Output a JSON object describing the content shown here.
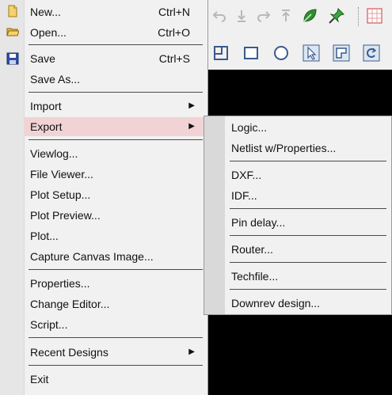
{
  "file_menu": {
    "items": [
      {
        "label": "New...",
        "shortcut": "Ctrl+N",
        "icon": "new-file-icon"
      },
      {
        "label": "Open...",
        "shortcut": "Ctrl+O",
        "icon": "open-folder-icon"
      },
      {
        "label": "Save",
        "shortcut": "Ctrl+S",
        "icon": "save-disk-icon"
      },
      {
        "label": "Save As...",
        "shortcut": ""
      },
      {
        "label": "Import",
        "shortcut": ""
      },
      {
        "label": "Export",
        "shortcut": ""
      },
      {
        "label": "Viewlog...",
        "shortcut": ""
      },
      {
        "label": "File Viewer...",
        "shortcut": ""
      },
      {
        "label": "Plot Setup...",
        "shortcut": ""
      },
      {
        "label": "Plot Preview...",
        "shortcut": ""
      },
      {
        "label": "Plot...",
        "shortcut": ""
      },
      {
        "label": "Capture Canvas Image...",
        "shortcut": ""
      },
      {
        "label": "Properties...",
        "shortcut": ""
      },
      {
        "label": "Change Editor...",
        "shortcut": ""
      },
      {
        "label": "Script...",
        "shortcut": ""
      },
      {
        "label": "Recent Designs",
        "shortcut": ""
      },
      {
        "label": "Exit",
        "shortcut": ""
      }
    ],
    "submenu_arrow": "▶"
  },
  "export_submenu": {
    "items": [
      {
        "label": "Logic..."
      },
      {
        "label": "Netlist w/Properties..."
      },
      {
        "label": "DXF..."
      },
      {
        "label": "IDF..."
      },
      {
        "label": "Pin delay..."
      },
      {
        "label": "Router..."
      },
      {
        "label": "Techfile..."
      },
      {
        "label": "Downrev design..."
      }
    ]
  },
  "colors": {
    "highlight": "#f2d3d5",
    "canvas": "#000000",
    "menu_bg": "#f1f1f1",
    "toolbar_bg": "#f0f0f0"
  }
}
